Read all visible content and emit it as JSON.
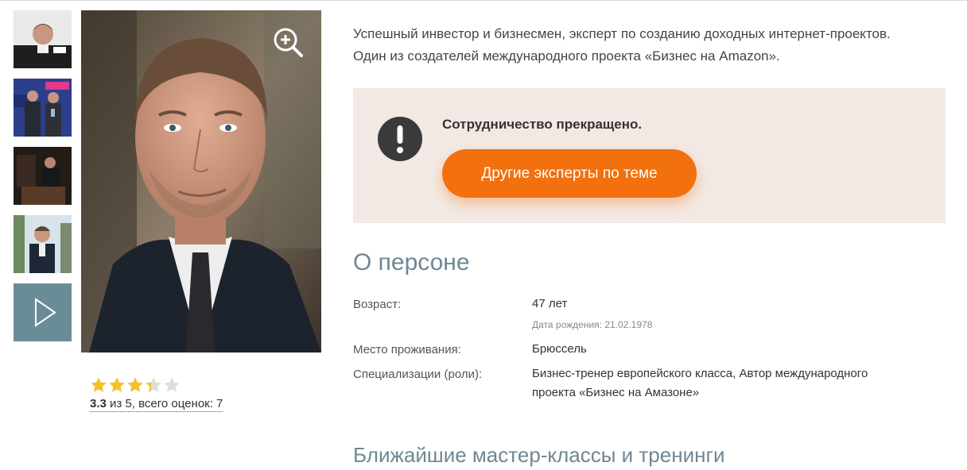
{
  "intro": {
    "line1": "Успешный инвестор и бизнесмен, эксперт по созданию доходных интернет-проектов.",
    "line2": "Один из создателей международного проекта «Бизнес на Amazon»."
  },
  "notice": {
    "title": "Сотрудничество прекращено.",
    "button_label": "Другие эксперты по теме",
    "icon": "exclamation-icon"
  },
  "about": {
    "heading": "О персоне",
    "age_label": "Возраст:",
    "age_value": "47 лет",
    "birth_date": "Дата рождения: 21.02.1978",
    "residence_label": "Место проживания:",
    "residence_value": "Брюссель",
    "roles_label": "Специализации (роли):",
    "roles_value_line1": "Бизнес-тренер европейского класса, Автор международного",
    "roles_value_line2": "проекта «Бизнес на Амазоне»"
  },
  "rating": {
    "score": "3.3",
    "rest": " из 5, всего оценок: 7",
    "stars_filled_fraction": 0.66
  },
  "upcoming": {
    "heading": "Ближайшие мастер-классы и тренинги"
  },
  "colors": {
    "accent": "#f2700d",
    "notice_bg": "#f3e9e4",
    "heading": "#6f8794",
    "star": "#f6c02a"
  }
}
